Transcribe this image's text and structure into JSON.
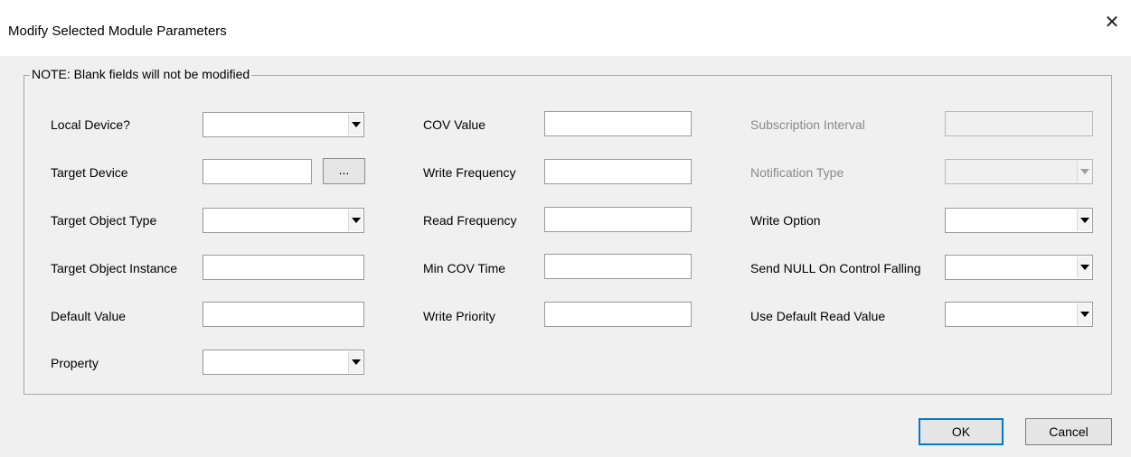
{
  "window": {
    "title": "Modify Selected Module Parameters",
    "close_symbol": "✕"
  },
  "group": {
    "legend": "NOTE: Blank fields will not be modified"
  },
  "col1": {
    "local_device": {
      "label": "Local Device?",
      "value": ""
    },
    "target_device": {
      "label": "Target Device",
      "value": "",
      "browse_label": "..."
    },
    "target_object_type": {
      "label": "Target Object Type",
      "value": ""
    },
    "target_object_instance": {
      "label": "Target Object Instance",
      "value": ""
    },
    "default_value": {
      "label": "Default Value",
      "value": ""
    },
    "property": {
      "label": "Property",
      "value": ""
    }
  },
  "col2": {
    "cov_value": {
      "label": "COV Value",
      "value": ""
    },
    "write_frequency": {
      "label": "Write Frequency",
      "value": ""
    },
    "read_frequency": {
      "label": "Read Frequency",
      "value": ""
    },
    "min_cov_time": {
      "label": "Min COV Time",
      "value": ""
    },
    "write_priority": {
      "label": "Write Priority",
      "value": ""
    }
  },
  "col3": {
    "subscription_interval": {
      "label": "Subscription Interval",
      "value": "",
      "enabled": false
    },
    "notification_type": {
      "label": "Notification Type",
      "value": "",
      "enabled": false
    },
    "write_option": {
      "label": "Write Option",
      "value": ""
    },
    "send_null_on_control_falling": {
      "label": "Send NULL On Control Falling",
      "value": ""
    },
    "use_default_read_value": {
      "label": "Use Default Read Value",
      "value": ""
    }
  },
  "buttons": {
    "ok": "OK",
    "cancel": "Cancel"
  },
  "icons": {
    "close": "close-icon",
    "dropdown": "chevron-down-icon"
  }
}
